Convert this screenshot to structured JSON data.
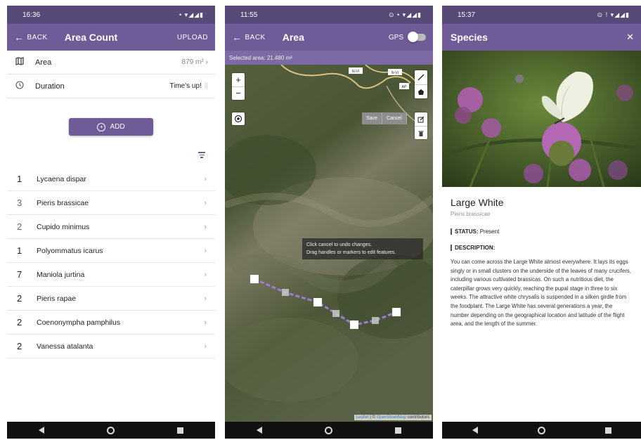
{
  "screen1": {
    "status_time": "16:36",
    "status_icons": "• ▾◢◢▮",
    "back_label": "BACK",
    "title": "Area Count",
    "upload_label": "UPLOAD",
    "area_label": "Area",
    "area_value": "879 m²",
    "duration_label": "Duration",
    "duration_value": "Time's up!",
    "add_label": "ADD",
    "species": [
      {
        "count": "1",
        "name": "Lycaena dispar",
        "highlight": false
      },
      {
        "count": "3",
        "name": "Pieris brassicae",
        "highlight": true
      },
      {
        "count": "2",
        "name": "Cupido minimus",
        "highlight": true
      },
      {
        "count": "1",
        "name": "Polyommatus icarus",
        "highlight": false
      },
      {
        "count": "7",
        "name": "Maniola jurtina",
        "highlight": false
      },
      {
        "count": "2",
        "name": "Pieris rapae",
        "highlight": false
      },
      {
        "count": "2",
        "name": "Coenonympha pamphilus",
        "highlight": false
      },
      {
        "count": "2",
        "name": "Vanessa atalanta",
        "highlight": false
      }
    ]
  },
  "screen2": {
    "status_time": "11:55",
    "status_icons": "⊙ • ▾◢◢▮",
    "back_label": "BACK",
    "title": "Area",
    "gps_label": "GPS",
    "selected_area": "Selected area: 21.480 m²",
    "zoom_in": "+",
    "zoom_out": "−",
    "save_label": "Save",
    "cancel_label": "Cancel",
    "tooltip_line1": "Click cancel to undo changes.",
    "tooltip_line2": "Drag handles or markers to edit features.",
    "road_label_1": "N-VI",
    "road_label_2": "N-VI",
    "road_label_3": "AP",
    "attribution_leaflet": "Leaflet",
    "attribution_osm": "OpenStreetMap",
    "attribution_rest": "contributors"
  },
  "screen3": {
    "status_time": "15:37",
    "status_icons": "⊙ ! ▾◢◢▮",
    "title": "Species",
    "close_icon": "✕",
    "name": "Large White",
    "latin": "Pieris brassicae",
    "status_label": "STATUS:",
    "status_value": "Present",
    "description_label": "DESCRIPTION:",
    "description": "You can come across the Large White almost everywhere. It lays its eggs singly or in small clusters on the underside of the leaves of many crucifers, including various cultivated brassicas. On such a nutritious diet, the caterpillar grows very quickly, reaching the pupal stage in three to six weeks. The attractive white chrysalis is suspended in a silken girdle from the foodplant. The Large White has several generations a year, the number depending on the geographical location and latitude of the flight area, and the length of the summer."
  },
  "colors": {
    "status_bar": "#584a78",
    "app_bar": "#6e5b98",
    "accent": "#6e5b98",
    "area_line": "#8a6ac8"
  }
}
